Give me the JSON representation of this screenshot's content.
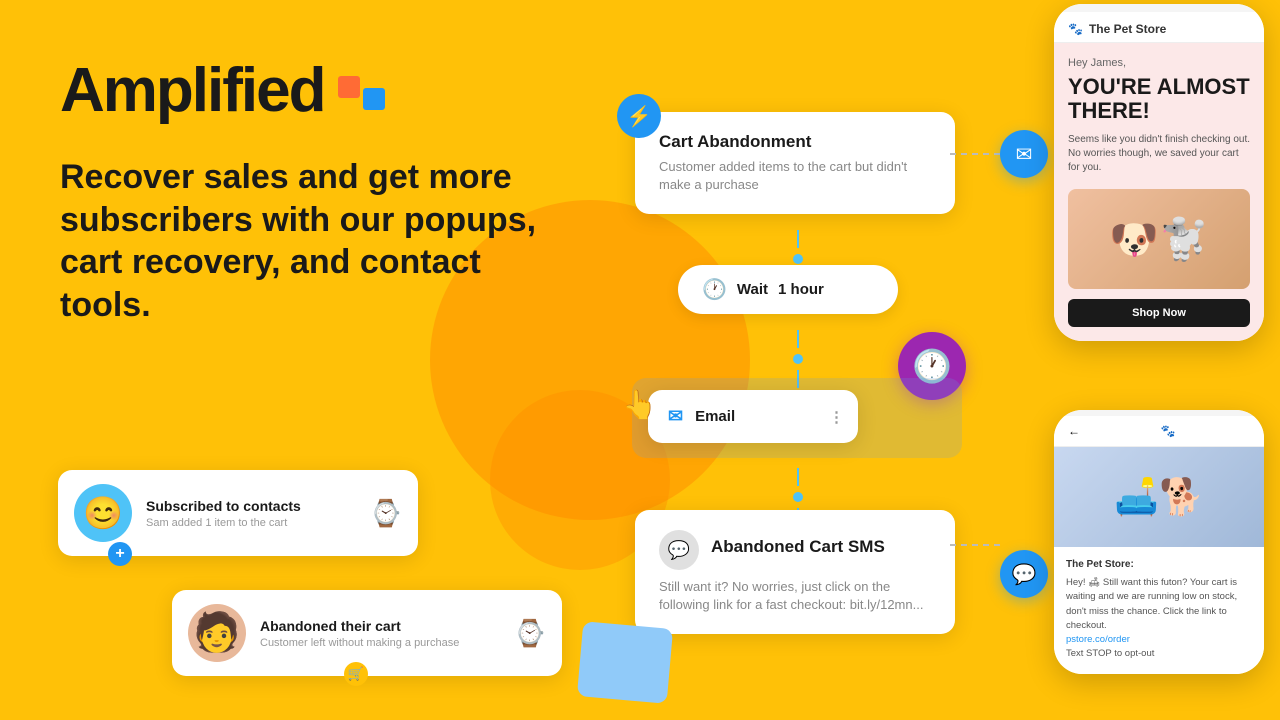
{
  "logo": {
    "text": "Amplified"
  },
  "tagline": "Recover sales and get more subscribers with our popups, cart recovery, and contact tools.",
  "workflow": {
    "cart_card": {
      "title": "Cart Abandonment",
      "description": "Customer added items to the cart but didn't make a purchase"
    },
    "wait_pill": {
      "label": "Wait",
      "duration": "1 hour"
    },
    "email_card": {
      "label": "Email"
    },
    "sms_card": {
      "title": "Abandoned Cart SMS",
      "description": "Still want it? No worries, just click on the following link for a fast checkout: bit.ly/12mn..."
    }
  },
  "email_preview": {
    "store_name": "The Pet Store",
    "greeting": "Hey James,",
    "headline": "YOU'RE ALMOST THERE!",
    "body": "Seems like you didn't finish checking out. No worries though, we saved your cart for you.",
    "cta": "Shop Now"
  },
  "sms_preview": {
    "store_name": "The Pet Store:",
    "message": "Hey! 🛋 Still want this futon? Your cart is waiting and we are running low on stock, don't miss the chance. Click the link to checkout.",
    "shop_link": "pstore.co/order",
    "optout": "Text STOP to opt-out"
  },
  "badge1": {
    "title": "Subscribed to contacts",
    "subtitle": "Sam added 1 item to the cart",
    "product_emoji": "⌚"
  },
  "badge2": {
    "title": "Abandoned their cart",
    "subtitle": "Customer left without making a purchase",
    "product_emoji": "⌚"
  },
  "icons": {
    "lightning": "⚡",
    "clock_orange": "🕐",
    "email": "✉",
    "sms_bubble": "💬",
    "clock_purple": "🕐",
    "paw": "🐾",
    "back_arrow": "←",
    "plus": "+",
    "cart": "🛒"
  }
}
